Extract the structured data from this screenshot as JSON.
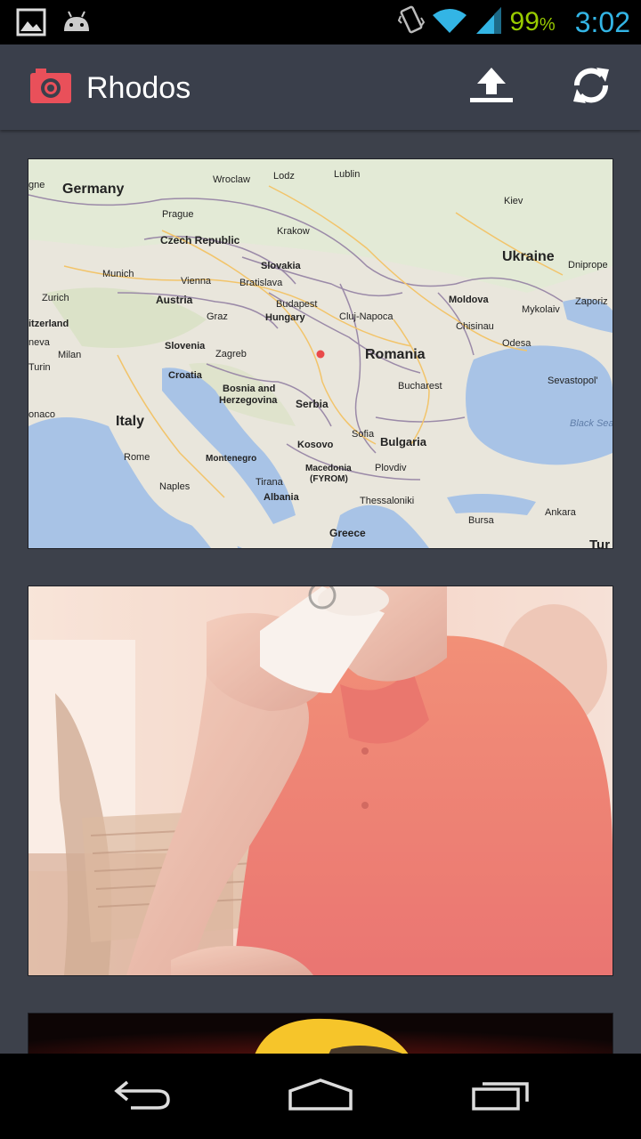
{
  "status_bar": {
    "icons": [
      "image-notification-icon",
      "android-notification-icon",
      "vibrate-icon",
      "wifi-icon",
      "signal-icon"
    ],
    "battery_number": "99",
    "battery_symbol": "%",
    "time": "3:02"
  },
  "action_bar": {
    "title": "Rhodos",
    "app_icon": "camera-icon",
    "actions": [
      "upload-icon",
      "refresh-icon"
    ],
    "accent_color": "#e9505a"
  },
  "feed": {
    "map_card": {
      "labels": {
        "germany": "Germany",
        "wroclaw": "Wroclaw",
        "lodz": "Lodz",
        "lublin": "Lublin",
        "kiev": "Kiev",
        "prague": "Prague",
        "krakow": "Krakow",
        "czech": "Czech Republic",
        "ukraine": "Ukraine",
        "slovakia": "Slovakia",
        "dnipro": "Dnipropе",
        "munich": "Munich",
        "vienna": "Vienna",
        "bratislava": "Bratislava",
        "zurich": "Zurich",
        "austria": "Austria",
        "budapest": "Budapest",
        "moldova": "Moldova",
        "zaporiz": "Zaporiz",
        "switzerland": "itzerland",
        "graz": "Graz",
        "hungary": "Hungary",
        "cluj": "Cluj-Napoca",
        "chisinau": "Chisinau",
        "mykolaiv": "Mykolaiv",
        "neva": "neva",
        "milan": "Milan",
        "slovenia": "Slovenia",
        "zagreb": "Zagreb",
        "odesa": "Odesa",
        "romania": "Romania",
        "turin": "Turin",
        "croatia": "Croatia",
        "sevastopol": "Sevastopol'",
        "bosnia1": "Bosnia and",
        "bosnia2": "Herzegovina",
        "bucharest": "Bucharest",
        "serbia": "Serbia",
        "monaco": "onaco",
        "italy": "Italy",
        "black_sea": "Black Sea",
        "sofia": "Sofia",
        "bulgaria": "Bulgaria",
        "kosovo": "Kosovo",
        "rome": "Rome",
        "montenegro": "Montenegro",
        "macedonia1": "Macedonia",
        "macedonia2": "(FYROM)",
        "plovdiv": "Plovdiv",
        "ankara": "Ankara",
        "naples": "Naples",
        "tirana": "Tirana",
        "albania": "Albania",
        "thessaloniki": "Thessaloniki",
        "bursa": "Bursa",
        "greece": "Greece",
        "tur": "Tur",
        "gne": "gne"
      }
    },
    "photo_card": {
      "subject": "person-drinking-coffee-photo"
    },
    "third_card": {
      "subject": "yellow-character-photo"
    }
  },
  "nav_bar": {
    "buttons": [
      "back-icon",
      "home-icon",
      "recent-apps-icon"
    ]
  }
}
